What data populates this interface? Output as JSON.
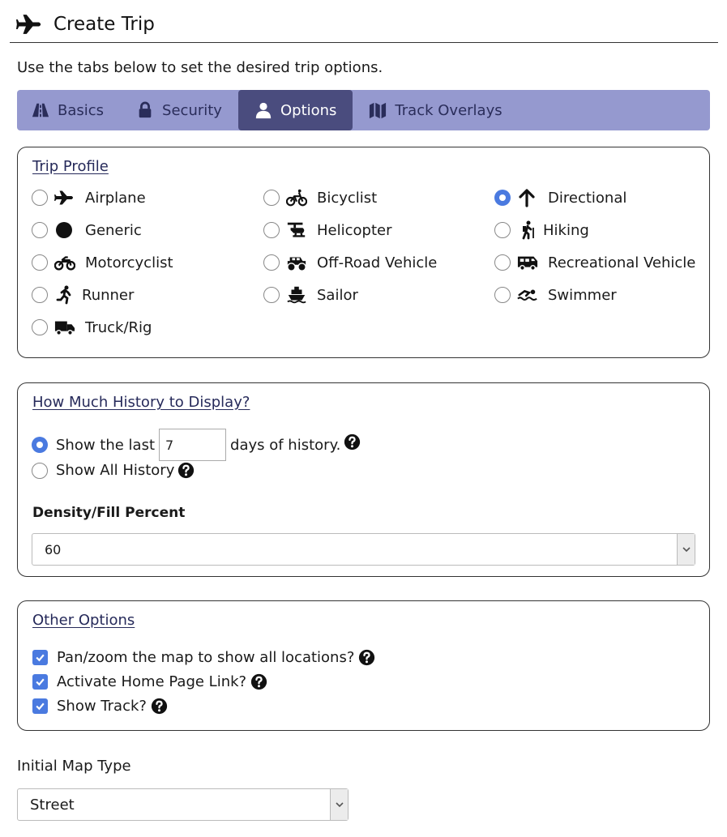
{
  "header": {
    "title": "Create Trip",
    "icon": "airplane-icon"
  },
  "intro": "Use the tabs below to set the desired trip options.",
  "tabs": [
    {
      "label": "Basics",
      "icon": "road-icon",
      "active": false
    },
    {
      "label": "Security",
      "icon": "lock-icon",
      "active": false
    },
    {
      "label": "Options",
      "icon": "user-icon",
      "active": true
    },
    {
      "label": "Track Overlays",
      "icon": "map-icon",
      "active": false
    }
  ],
  "trip_profile": {
    "title": "Trip Profile",
    "options": [
      {
        "label": "Airplane",
        "icon": "airplane-icon",
        "checked": false
      },
      {
        "label": "Bicyclist",
        "icon": "bicycle-icon",
        "checked": false
      },
      {
        "label": "Directional",
        "icon": "arrow-up-icon",
        "checked": true
      },
      {
        "label": "Generic",
        "icon": "circle-icon",
        "checked": false
      },
      {
        "label": "Helicopter",
        "icon": "helicopter-icon",
        "checked": false
      },
      {
        "label": "Hiking",
        "icon": "hiking-icon",
        "checked": false
      },
      {
        "label": "Motorcyclist",
        "icon": "motorcycle-icon",
        "checked": false
      },
      {
        "label": "Off-Road Vehicle",
        "icon": "monster-truck-icon",
        "checked": false
      },
      {
        "label": "Recreational Vehicle",
        "icon": "rv-icon",
        "checked": false
      },
      {
        "label": "Runner",
        "icon": "runner-icon",
        "checked": false
      },
      {
        "label": "Sailor",
        "icon": "ship-icon",
        "checked": false
      },
      {
        "label": "Swimmer",
        "icon": "swimmer-icon",
        "checked": false
      },
      {
        "label": "Truck/Rig",
        "icon": "truck-icon",
        "checked": false
      }
    ]
  },
  "history": {
    "title": "How Much History to Display?",
    "show_last_prefix": "Show the last",
    "days_value": "7",
    "show_last_suffix": "days of history.",
    "show_last_checked": true,
    "show_all_label": "Show All History",
    "show_all_checked": false,
    "density_label": "Density/Fill Percent",
    "density_value": "60"
  },
  "other_options": {
    "title": "Other Options",
    "items": [
      {
        "label": "Pan/zoom the map to show all locations?",
        "checked": true
      },
      {
        "label": "Activate Home Page Link?",
        "checked": true
      },
      {
        "label": "Show Track?",
        "checked": true
      }
    ]
  },
  "map_type": {
    "label": "Initial Map Type",
    "value": "Street"
  },
  "colors": {
    "tab_bar": "#9599cf",
    "tab_active": "#4a4c7e",
    "accent": "#4a7ae0",
    "link": "#262a5a"
  }
}
